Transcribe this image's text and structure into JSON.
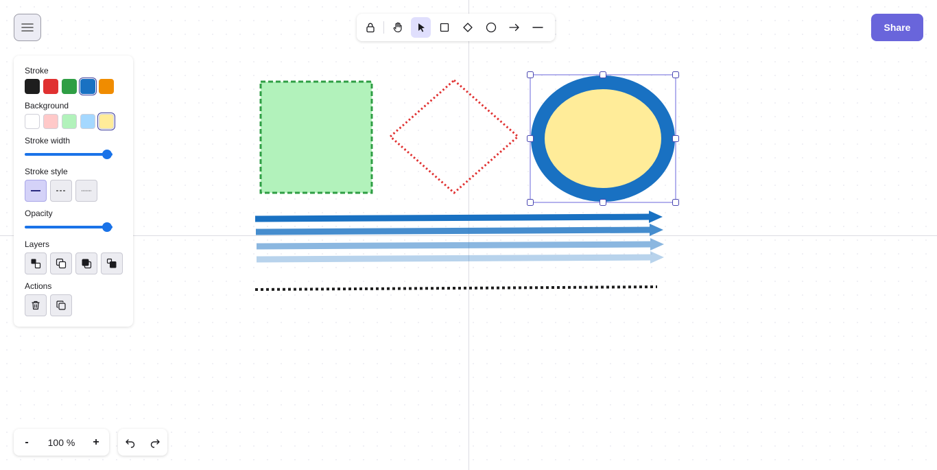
{
  "app": {
    "share_label": "Share"
  },
  "toolbar": {
    "tools": [
      {
        "id": "lock",
        "icon": "lock-icon"
      },
      {
        "id": "hand",
        "icon": "hand-icon"
      },
      {
        "id": "selection",
        "icon": "pointer-icon",
        "active": true
      },
      {
        "id": "rectangle",
        "icon": "rectangle-icon"
      },
      {
        "id": "diamond",
        "icon": "diamond-icon"
      },
      {
        "id": "ellipse",
        "icon": "ellipse-icon"
      },
      {
        "id": "arrow",
        "icon": "arrow-icon"
      },
      {
        "id": "line",
        "icon": "line-icon"
      }
    ]
  },
  "panel": {
    "stroke_label": "Stroke",
    "stroke_colors": [
      "#1e1e1e",
      "#e03131",
      "#2f9e44",
      "#1971c2",
      "#f08c00"
    ],
    "stroke_selected": "#1971c2",
    "background_label": "Background",
    "background_colors": [
      "#ffffff",
      "#ffc9c9",
      "#b2f2bb",
      "#a5d8ff",
      "#ffec99"
    ],
    "background_selected": "#ffec99",
    "stroke_width_label": "Stroke width",
    "stroke_width_value": 1.0,
    "stroke_style_label": "Stroke style",
    "stroke_styles": [
      "solid",
      "dashed",
      "dotted"
    ],
    "stroke_style_selected": "solid",
    "opacity_label": "Opacity",
    "opacity_value": 100,
    "layers_label": "Layers",
    "layer_actions": [
      "send-to-back-icon",
      "send-backward-icon",
      "bring-forward-icon",
      "bring-to-front-icon"
    ],
    "actions_label": "Actions",
    "actions": [
      "trash-icon",
      "duplicate-icon"
    ]
  },
  "zoom": {
    "minus": "-",
    "value": "100 %",
    "plus": "+"
  },
  "history": {
    "undo_icon": "undo-icon",
    "redo_icon": "redo-icon"
  },
  "canvas": {
    "accent": "#6965db",
    "rectangle": {
      "stroke": "#2f9e44",
      "fill": "#b2f2bb",
      "style": "dashed"
    },
    "diamond": {
      "stroke": "#e03131",
      "fill": "none",
      "style": "dotted"
    },
    "ellipse": {
      "stroke": "#1971c2",
      "fill": "#ffec99",
      "style": "solid",
      "selected": true
    },
    "arrows": [
      {
        "color": "#1971c2",
        "opacity": 1.0
      },
      {
        "color": "#1971c2",
        "opacity": 0.8
      },
      {
        "color": "#1971c2",
        "opacity": 0.5
      },
      {
        "color": "#1971c2",
        "opacity": 0.3
      }
    ],
    "dotted_line": {
      "color": "#1e1e1e",
      "style": "dotted"
    }
  }
}
